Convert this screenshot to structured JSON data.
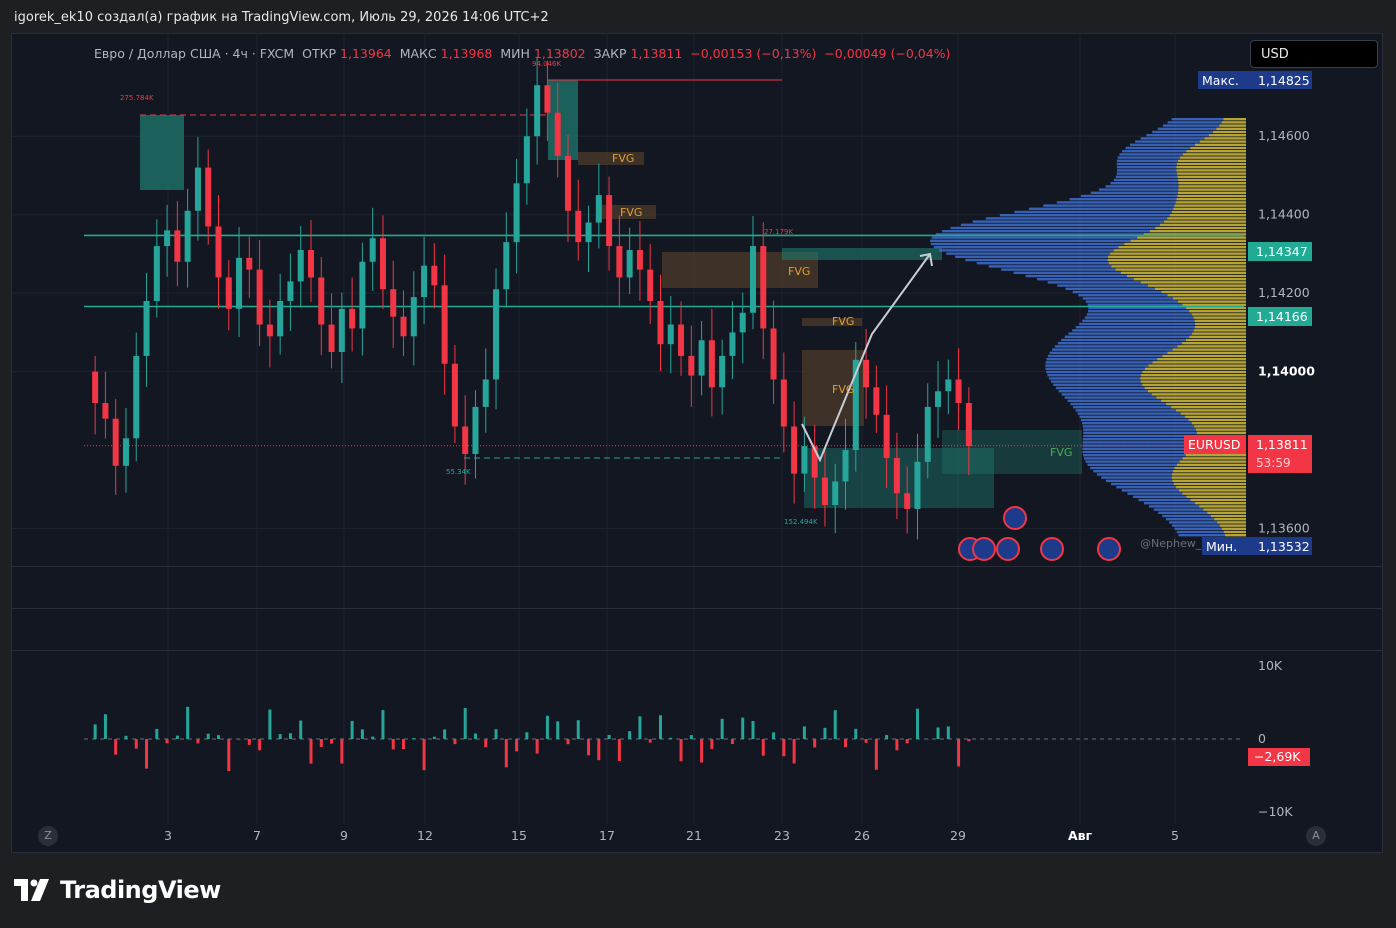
{
  "caption": "igorek_ek10 создал(а) график на TradingView.com, Июль 29, 2026 14:06 UTC+2",
  "legend": {
    "symbol": "Евро / Доллар США · 4ч · FXCM",
    "open_label": "ОТКР",
    "open": "1,13964",
    "high_label": "МАКС",
    "high": "1,13968",
    "low_label": "МИН",
    "low": "1,13802",
    "close_label": "ЗАКР",
    "close": "1,13811",
    "change": "−0,00153 (−0,13%)",
    "change2": "−0,00049 (−0,04%)"
  },
  "currency_button": "USD",
  "price_scale": {
    "ticks": [
      "1,14600",
      "1,14400",
      "1,14200",
      "1,14000",
      "1,13600"
    ],
    "tick_values": [
      1.146,
      1.144,
      1.142,
      1.14,
      1.136
    ],
    "bold_tick": "1,14000",
    "max_label": "Макс.",
    "max_value": "1,14825",
    "min_label": "Мин.",
    "min_value": "1,13532",
    "level1": "1,14347",
    "level1_value": 1.14347,
    "level2": "1,14166",
    "level2_value": 1.14166,
    "symbol_tag": "EURUSD",
    "last_price": "1,13811",
    "countdown": "53:59",
    "last_value": 1.13811
  },
  "volume_scale": {
    "ticks": [
      "10K",
      "0",
      "−10K"
    ],
    "last": "−2,69K"
  },
  "time_axis": {
    "labels": [
      "3",
      "7",
      "9",
      "12",
      "15",
      "17",
      "21",
      "23",
      "26",
      "29",
      "Авг",
      "5"
    ]
  },
  "annotations": {
    "vol_275": "275.784K",
    "vol_94": "94.046K",
    "vol_27": "27.179K",
    "vol_55": "55.34K",
    "vol_152": "152.494K",
    "fvg": "FVG",
    "watermark": "@Nephew_"
  },
  "axis_buttons": {
    "left": "Z",
    "right": "A"
  },
  "brand": "TradingView",
  "colors": {
    "bg": "#131722",
    "up": "#26a69a",
    "down": "#f23645",
    "profile_blue": "#3d6fd1",
    "profile_yellow": "#c9b43a",
    "level_green": "#22ab94",
    "fvg_fill": "#4a3a2a"
  },
  "chart_data": {
    "type": "candlestick",
    "symbol": "EURUSD",
    "timeframe": "4h",
    "ylim": [
      1.1353,
      1.1483
    ],
    "x_labels": [
      "3",
      "7",
      "9",
      "12",
      "15",
      "17",
      "21",
      "23",
      "26",
      "29",
      "Авг",
      "5"
    ],
    "last": {
      "open": 1.13964,
      "high": 1.13968,
      "low": 1.13802,
      "close": 1.13811
    },
    "closes": [
      1.1392,
      1.1388,
      1.1376,
      1.1383,
      1.1404,
      1.1418,
      1.1432,
      1.1436,
      1.1428,
      1.1441,
      1.1452,
      1.1437,
      1.1424,
      1.1416,
      1.1429,
      1.1426,
      1.1412,
      1.1409,
      1.1418,
      1.1423,
      1.1431,
      1.1424,
      1.1412,
      1.1405,
      1.1416,
      1.1411,
      1.1428,
      1.1434,
      1.1421,
      1.1414,
      1.1409,
      1.1419,
      1.1427,
      1.1422,
      1.1402,
      1.1386,
      1.1379,
      1.1391,
      1.1398,
      1.1421,
      1.1433,
      1.1448,
      1.146,
      1.1473,
      1.1466,
      1.1455,
      1.1441,
      1.1433,
      1.1438,
      1.1445,
      1.1432,
      1.1424,
      1.1431,
      1.1426,
      1.1418,
      1.1407,
      1.1412,
      1.1404,
      1.1399,
      1.1408,
      1.1396,
      1.1404,
      1.141,
      1.1415,
      1.1432,
      1.1411,
      1.1398,
      1.1386,
      1.1374,
      1.1381,
      1.1373,
      1.1366,
      1.1372,
      1.138,
      1.1403,
      1.1396,
      1.1389,
      1.1378,
      1.1369,
      1.1365,
      1.1377,
      1.1391,
      1.1395,
      1.1398,
      1.1392,
      1.1381
    ],
    "volume_range": [
      -10000,
      10000
    ],
    "volume_last": -2690
  }
}
